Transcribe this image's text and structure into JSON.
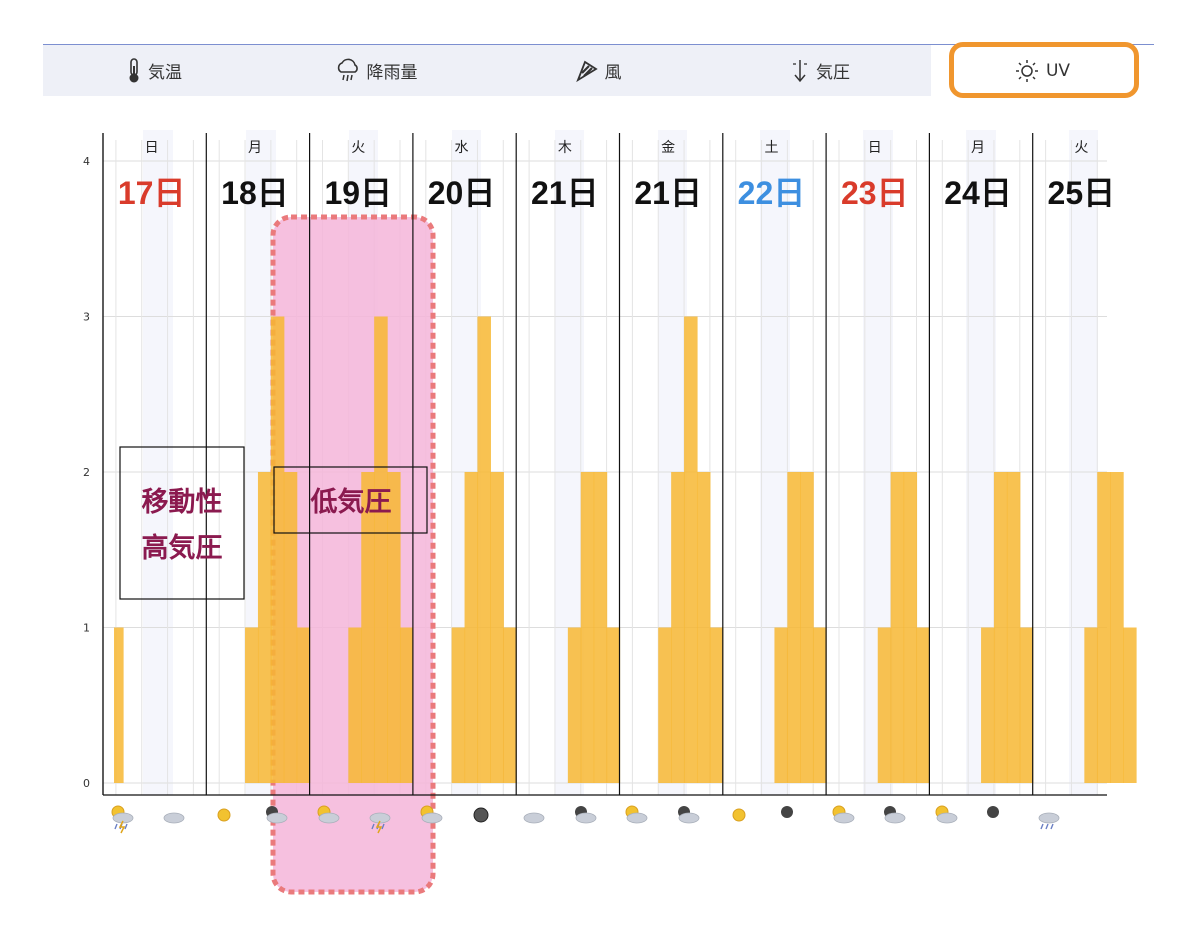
{
  "tabs": [
    {
      "label": "気温",
      "icon": "thermometer-icon",
      "selected": false
    },
    {
      "label": "降雨量",
      "icon": "rain-cloud-icon",
      "selected": false
    },
    {
      "label": "風",
      "icon": "wind-sock-icon",
      "selected": false
    },
    {
      "label": "気圧",
      "icon": "pressure-arrow-icon",
      "selected": false
    },
    {
      "label": "UV",
      "icon": "sun-icon",
      "selected": true
    }
  ],
  "colors": {
    "bar": "#f7b733",
    "highlight_fill": "#f4b5d9",
    "highlight_border": "#ea7a7c",
    "tab_outline": "#f0962e",
    "annotation_text": "#8b1a4f",
    "red_date": "#d93b2b",
    "blue_date": "#3d8fe0"
  },
  "days": [
    {
      "dow": "日",
      "date": "17日",
      "color": "#d93b2b"
    },
    {
      "dow": "月",
      "date": "18日",
      "color": "#111111"
    },
    {
      "dow": "火",
      "date": "19日",
      "color": "#111111"
    },
    {
      "dow": "水",
      "date": "20日",
      "color": "#111111"
    },
    {
      "dow": "木",
      "date": "21日",
      "color": "#111111"
    },
    {
      "dow": "金",
      "date": "21日",
      "color": "#111111"
    },
    {
      "dow": "土",
      "date": "22日",
      "color": "#3d8fe0"
    },
    {
      "dow": "日",
      "date": "23日",
      "color": "#d93b2b"
    },
    {
      "dow": "月",
      "date": "24日",
      "color": "#111111"
    },
    {
      "dow": "火",
      "date": "25日",
      "color": "#111111"
    }
  ],
  "annotations": [
    {
      "lines": [
        "移動性",
        "高気圧"
      ]
    },
    {
      "lines": [
        "低気圧"
      ]
    }
  ],
  "weather_icons": [
    "sun-thunder-rain-icon",
    "cloud-icon",
    "sun-icon",
    "cloud-night-icon",
    "sun-cloud-icon",
    "thunder-rain-icon",
    "sun-cloud-icon",
    "moon-icon",
    "cloud-icon",
    "cloud-night-icon",
    "sun-cloud-icon",
    "cloud-night-icon",
    "sun-icon",
    "night-icon",
    "sun-cloud-icon",
    "cloud-night-icon",
    "sun-cloud-icon",
    "night-icon",
    "rain-cloud-icon"
  ],
  "chart_data": {
    "type": "bar",
    "ylim": [
      0,
      4
    ],
    "yticks": [
      "0",
      "1",
      "2",
      "3",
      "4"
    ],
    "grid": true,
    "series": [
      {
        "values": [
          [
            1,
            0,
            0,
            0,
            0,
            0,
            0,
            0
          ],
          [
            0,
            0,
            0,
            1,
            2,
            3,
            2,
            1
          ],
          [
            0,
            0,
            0,
            1,
            2,
            3,
            2,
            1
          ],
          [
            0,
            0,
            0,
            1,
            2,
            3,
            2,
            1
          ],
          [
            0,
            0,
            0,
            0,
            1,
            2,
            2,
            1
          ],
          [
            0,
            0,
            0,
            1,
            2,
            3,
            2,
            1
          ],
          [
            0,
            0,
            0,
            0,
            1,
            2,
            2,
            1
          ],
          [
            0,
            0,
            0,
            0,
            1,
            2,
            2,
            1
          ],
          [
            0,
            0,
            0,
            0,
            1,
            2,
            2,
            1
          ],
          [
            0,
            0,
            0,
            0,
            1,
            2,
            2,
            1
          ]
        ]
      }
    ]
  }
}
